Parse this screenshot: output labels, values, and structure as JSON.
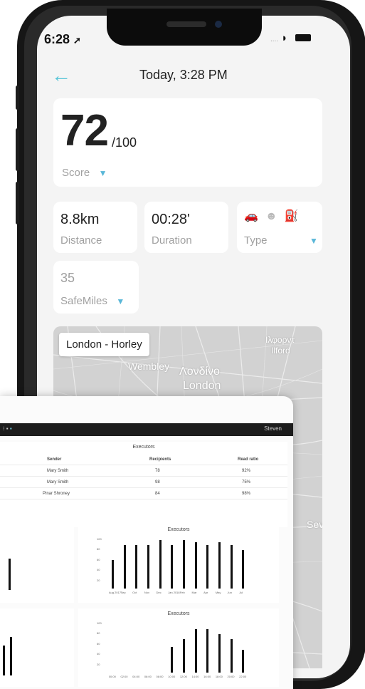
{
  "status": {
    "time": "6:28",
    "signal_dots": "....",
    "wifi_icon": "wifi-icon",
    "battery_icon": "battery-icon"
  },
  "header": {
    "back_icon": "arrow-left-icon",
    "title": "Today, 3:28 PM"
  },
  "score": {
    "value": "72",
    "max": "/100",
    "label": "Score"
  },
  "stats": {
    "distance": {
      "value": "8.8km",
      "label": "Distance"
    },
    "duration": {
      "value": "00:28'",
      "label": "Duration"
    },
    "type": {
      "label": "Type",
      "icons": [
        "car-icon",
        "pedestrian-icon",
        "fuel-icon"
      ]
    }
  },
  "safemiles": {
    "value": "35",
    "label": "SafeMiles"
  },
  "map": {
    "route": "London - Horley",
    "labels": [
      "Λονδίνο",
      "London",
      "Ιλφορντ",
      "Ilford",
      "Wembley",
      "Sev"
    ]
  },
  "dashboard": {
    "topbar_left": "(arrow)",
    "topbar_right": "Steven",
    "table": {
      "title": "Executors",
      "headers": [
        "Sender",
        "Recipients",
        "Read ratio"
      ],
      "rows": [
        [
          "Mary Smith",
          "78",
          "92%"
        ],
        [
          "Mary Smith",
          "98",
          "75%"
        ],
        [
          "Pinar Shroney",
          "84",
          "98%"
        ]
      ]
    },
    "chart_titles": [
      "Executors",
      "Executors"
    ],
    "chart_data": [
      {
        "type": "bar",
        "title": "Executors",
        "categories": [
          "Aug 2017",
          "Sep",
          "Oct",
          "Nov",
          "Dec",
          "Jan 2018",
          "Feb",
          "Mar",
          "Apr",
          "May",
          "Jun",
          "Jul"
        ],
        "values": [
          55,
          85,
          85,
          85,
          95,
          85,
          95,
          90,
          85,
          90,
          85,
          75
        ],
        "ylim": [
          0,
          100
        ],
        "yticks": [
          "100",
          "80",
          "60",
          "40",
          "20"
        ]
      },
      {
        "type": "bar",
        "title": "Executors",
        "categories": [
          "00:00",
          "02:00",
          "04:00",
          "06:00",
          "08:00",
          "10:00",
          "12:00",
          "14:00",
          "16:00",
          "18:00",
          "20:00",
          "22:00"
        ],
        "values": [
          0,
          0,
          0,
          0,
          0,
          50,
          65,
          85,
          85,
          75,
          65,
          45
        ],
        "ylim": [
          0,
          100
        ],
        "yticks": [
          "100",
          "80",
          "60",
          "40",
          "20"
        ]
      }
    ]
  }
}
